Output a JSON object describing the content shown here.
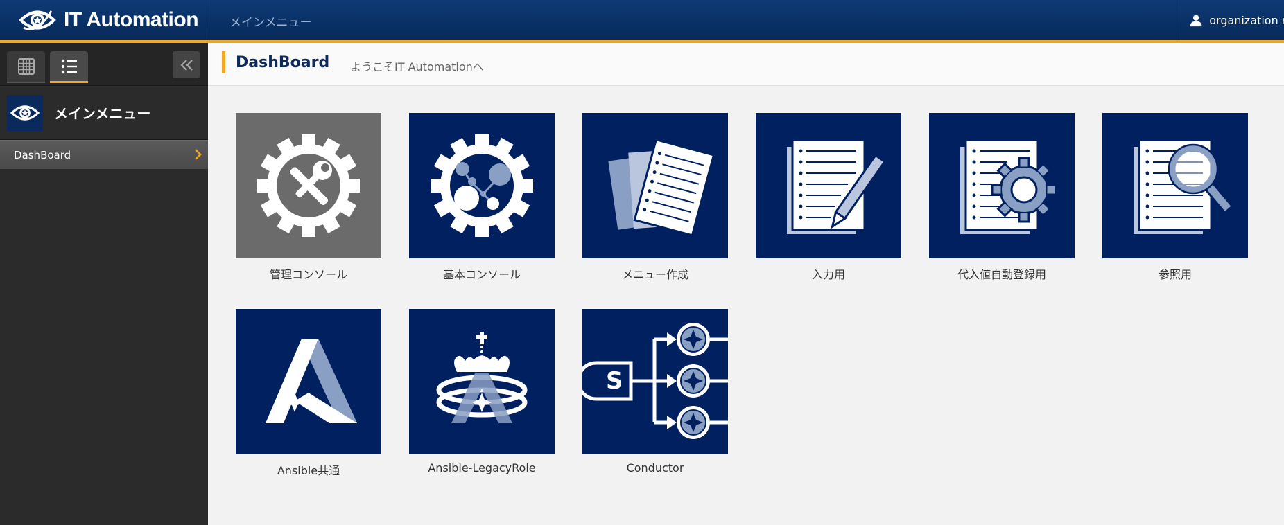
{
  "header": {
    "app_title": "IT Automation",
    "menu_label": "メインメニュー",
    "user_name": "organization ma"
  },
  "sidebar": {
    "menu_title": "メインメニュー",
    "items": [
      {
        "label": "DashBoard"
      }
    ]
  },
  "main": {
    "title": "DashBoard",
    "subtitle": "ようこそIT Automationへ",
    "tiles": [
      {
        "label": "管理コンソール",
        "icon": "gear-tools-icon"
      },
      {
        "label": "基本コンソール",
        "icon": "gear-network-icon"
      },
      {
        "label": "メニュー作成",
        "icon": "documents-icon"
      },
      {
        "label": "入力用",
        "icon": "document-pencil-icon"
      },
      {
        "label": "代入値自動登録用",
        "icon": "document-gear-icon"
      },
      {
        "label": "参照用",
        "icon": "document-magnifier-icon"
      },
      {
        "label": "Ansible共通",
        "icon": "ansible-a-icon"
      },
      {
        "label": "Ansible-LegacyRole",
        "icon": "ansible-crown-icon"
      },
      {
        "label": "Conductor",
        "icon": "conductor-flow-icon"
      }
    ]
  },
  "colors": {
    "header_bg": "#072a5a",
    "accent": "#f5a623",
    "tile_bg": "#002060",
    "tile_gray": "#6b6b6b",
    "sidebar_bg": "#2b2b2b"
  }
}
